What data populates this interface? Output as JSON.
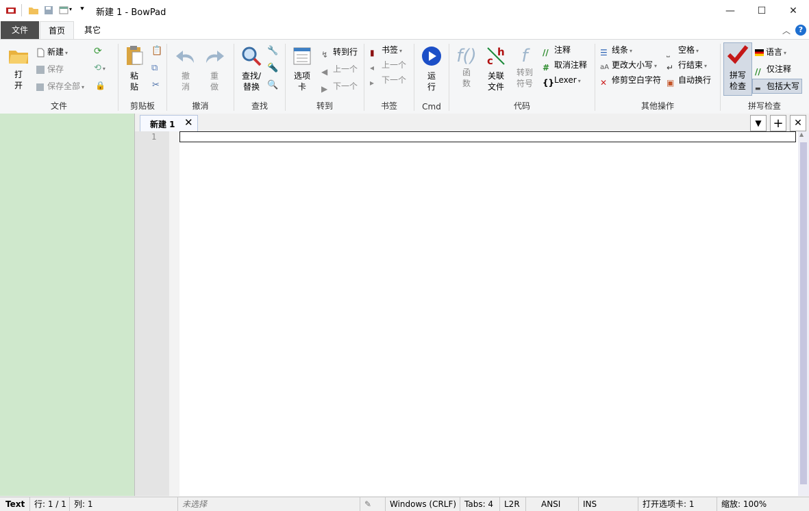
{
  "window": {
    "title": "新建 1 - BowPad",
    "controls": [
      "minimize-icon",
      "maximize-icon",
      "close-icon"
    ]
  },
  "menu_tabs": {
    "file": "文件",
    "home": "首页",
    "other": "其它"
  },
  "ribbon": {
    "file_group": {
      "open": "打\n开",
      "new": "新建",
      "save": "保存",
      "save_all": "保存全部",
      "label": "文件"
    },
    "clipboard_group": {
      "paste": "粘\n贴",
      "label": "剪贴板"
    },
    "undo_group": {
      "undo": "撤\n消",
      "redo": "重\n做",
      "label": "撤消"
    },
    "find_group": {
      "find_replace": "查找/\n替换",
      "label": "查找"
    },
    "goto_group": {
      "tabs": "选项\n卡",
      "goto_line": "转到行",
      "prev": "上一个",
      "next": "下一个",
      "label": "转到"
    },
    "bookmark_group": {
      "bookmark": "书签",
      "prev": "上一个",
      "next": "下一个",
      "label": "书签"
    },
    "cmd_group": {
      "run": "运\n行",
      "label": "Cmd"
    },
    "code_group": {
      "function": "函\n数",
      "related_file": "关联\n文件",
      "goto_symbol": "转到\n符号",
      "comment": "注释",
      "uncomment": "取消注释",
      "lexer": "Lexer",
      "label": "代码"
    },
    "other_group": {
      "lines": "线条",
      "change_case": "更改大小写",
      "trim_whitespace": "修剪空白字符",
      "spaces": "空格",
      "line_endings": "行结束",
      "autowrap": "自动换行",
      "label": "其他操作"
    },
    "spell_group": {
      "spellcheck": "拼写\n检查",
      "language": "语言",
      "comments_only": "仅注释",
      "include_upper": "包括大写",
      "label": "拼写检查"
    }
  },
  "tabs": [
    {
      "label": "新建 1"
    }
  ],
  "editor": {
    "line_number": "1"
  },
  "status": {
    "lexer": "Text",
    "line": "行: 1 / 1",
    "col": "列: 1",
    "selection": "未选择",
    "eol": "Windows (CRLF)",
    "tabs": "Tabs: 4",
    "dir": "L2R",
    "encoding": "ANSI",
    "ins": "INS",
    "open_tabs": "打开选项卡: 1",
    "zoom": "缩放: 100%"
  },
  "colors": {
    "accent_file_tab": "#4a4a4a",
    "left_panel": "#cfe8cc",
    "help": "#1e6fd0"
  }
}
